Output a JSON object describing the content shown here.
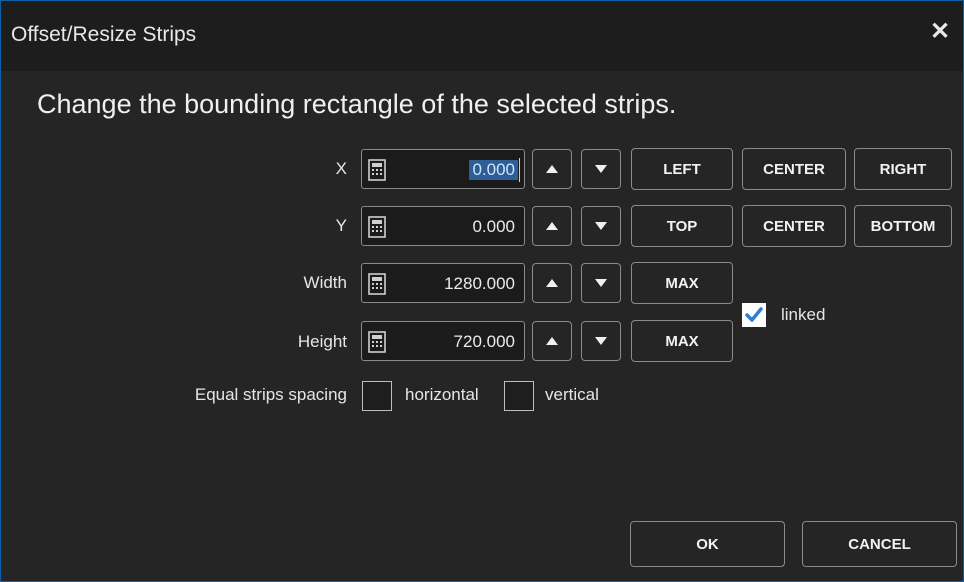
{
  "window": {
    "title": "Offset/Resize Strips",
    "close_glyph": "✕"
  },
  "prompt": "Change the bounding rectangle of the selected strips.",
  "fields": {
    "x": {
      "label": "X",
      "value": "0.000"
    },
    "y": {
      "label": "Y",
      "value": "0.000"
    },
    "width": {
      "label": "Width",
      "value": "1280.000"
    },
    "height": {
      "label": "Height",
      "value": "720.000"
    }
  },
  "align_x": {
    "left": "LEFT",
    "center": "CENTER",
    "right": "RIGHT"
  },
  "align_y": {
    "top": "TOP",
    "center": "CENTER",
    "bottom": "BOTTOM"
  },
  "max_width_label": "MAX",
  "max_height_label": "MAX",
  "linked": {
    "label": "linked",
    "checked": true
  },
  "spacing": {
    "label": "Equal strips spacing",
    "horizontal": {
      "label": "horizontal",
      "checked": false
    },
    "vertical": {
      "label": "vertical",
      "checked": false
    }
  },
  "footer": {
    "ok": "OK",
    "cancel": "CANCEL"
  },
  "colors": {
    "accent": "#2f7fd0",
    "background": "#252525",
    "titlebar": "#1d1d1d",
    "border": "#0f5fa8"
  },
  "icons": [
    "calculator-icon",
    "arrow-up-icon",
    "arrow-down-icon",
    "checkmark-icon",
    "close-icon"
  ]
}
